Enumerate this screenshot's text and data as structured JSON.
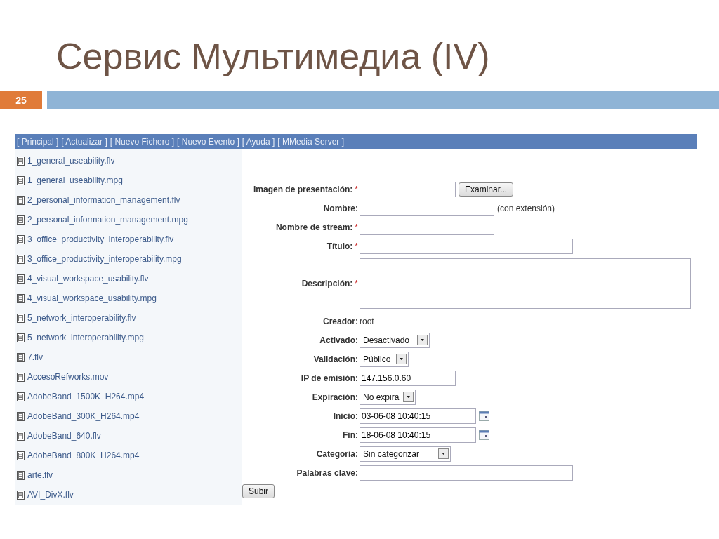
{
  "slide": {
    "title": "Сервис Мультимедиа (IV)",
    "number": "25"
  },
  "nav": [
    "[ Principal ]",
    "[ Actualizar ]",
    "[ Nuevo Fichero ]",
    "[ Nuevo Evento ]",
    "[ Ayuda ]",
    "[ MMedia Server ]"
  ],
  "files": [
    "1_general_useability.flv",
    "1_general_useability.mpg",
    "2_personal_information_management.flv",
    "2_personal_information_management.mpg",
    "3_office_productivity_interoperability.flv",
    "3_office_productivity_interoperability.mpg",
    "4_visual_workspace_usability.flv",
    "4_visual_workspace_usability.mpg",
    "5_network_interoperability.flv",
    "5_network_interoperability.mpg",
    "7.flv",
    "AccesoRefworks.mov",
    "AdobeBand_1500K_H264.mp4",
    "AdobeBand_300K_H264.mp4",
    "AdobeBand_640.flv",
    "AdobeBand_800K_H264.mp4",
    "arte.flv",
    "AVI_DivX.flv"
  ],
  "form": {
    "fields": [
      {
        "kind": "file",
        "label": "Imagen de presentación:",
        "required_mark": "*",
        "button": "Examinar..."
      },
      {
        "kind": "text",
        "label": "Nombre:",
        "note": "(con extensión)"
      },
      {
        "kind": "text",
        "label": "Nombre de stream:",
        "required_mark": "*"
      },
      {
        "kind": "text",
        "label": "Título:",
        "required_mark": "*"
      },
      {
        "kind": "textarea",
        "label": "Descripción:",
        "required_mark": "*"
      },
      {
        "kind": "static",
        "label": "Creador:",
        "value": "root"
      },
      {
        "kind": "select",
        "label": "Activado:",
        "value": "Desactivado"
      },
      {
        "kind": "select",
        "label": "Validación:",
        "value": "Público"
      },
      {
        "kind": "text",
        "label": "IP de emisión:",
        "value": "147.156.0.60"
      },
      {
        "kind": "select",
        "label": "Expiración:",
        "value": "No expira"
      },
      {
        "kind": "date",
        "label": "Inicio:",
        "value": "03-06-08 10:40:15"
      },
      {
        "kind": "date",
        "label": "Fin:",
        "value": "18-06-08 10:40:15"
      },
      {
        "kind": "select",
        "label": "Categoría:",
        "value": "Sin categorizar"
      },
      {
        "kind": "text",
        "label": "Palabras clave:"
      }
    ],
    "submit": "Subir"
  }
}
